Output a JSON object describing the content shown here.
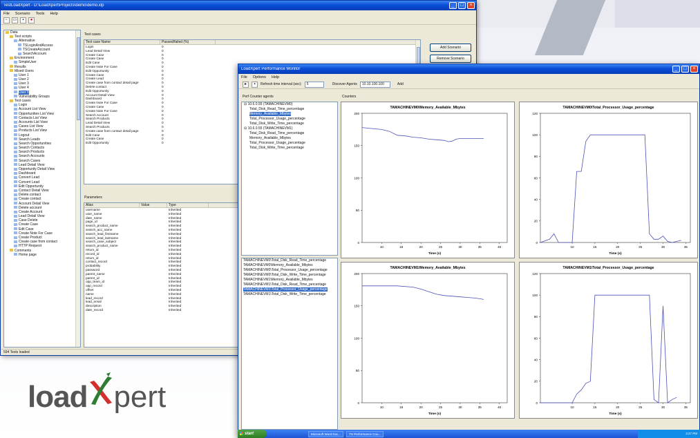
{
  "back_window": {
    "title": "TestLoadXpert - D:\\LoadXpert\\Projects\\demo\\demo.xlp",
    "menu": [
      "File",
      "Scenario",
      "Tools",
      "Help"
    ],
    "tree": [
      "Data",
      "Test scripts",
      "Alternative",
      "TSLoginAndAccess",
      "TSCreateAccount",
      "SearchAccount",
      "Environment",
      "SimpleUser",
      "Results",
      "Mixed Users",
      "User 1",
      "User 2",
      "User 3",
      "User 4",
      "User 5",
      "Vulnerability Groups",
      "Test cases",
      "Login",
      "Account List View",
      "Opportunities List View",
      "Contacts List View",
      "Accounts List View",
      "Cases List View",
      "Products List View",
      "Logout",
      "Search Leads",
      "Search Opportunities",
      "Search Contacts",
      "Search Products",
      "Search Accounts",
      "Search Cases",
      "Lead Detail View",
      "Opportunity Detail View",
      "Dashboard",
      "Convert Lead",
      "Convert Lead",
      "Edit Opportunity",
      "Contact Detail View",
      "Delete contact",
      "Create contact",
      "Account Detail View",
      "Delete account",
      "Create Account",
      "Lead Detail View",
      "Case Delete",
      "Create Case",
      "Edit Case",
      "Create Note For Case",
      "Create Product",
      "Create case from contact",
      "HTTP Request",
      "Comments",
      "Home page"
    ],
    "tree_selected": 14,
    "test_cases_label": "Test cases",
    "steps_header": [
      "Test case Name",
      "Passed/failed (%)"
    ],
    "steps": [
      [
        "Login",
        "0"
      ],
      [
        "Lead Detail View",
        "0"
      ],
      [
        "Create Case",
        "0"
      ],
      [
        "Create Case",
        "0"
      ],
      [
        "Edit Case",
        "0"
      ],
      [
        "Create Note For Case",
        "0"
      ],
      [
        "Edit Opportunity",
        "0"
      ],
      [
        "Create Case",
        "0"
      ],
      [
        "Create Lead",
        "0"
      ],
      [
        "Create case from contact detail page",
        "0"
      ],
      [
        "Delete contact",
        "0"
      ],
      [
        "Edit Opportunity",
        "0"
      ],
      [
        "Account Detail View",
        "0"
      ],
      [
        "Dashboard",
        "0"
      ],
      [
        "Create Note For Case",
        "0"
      ],
      [
        "Create Case",
        "0"
      ],
      [
        "Create Note For Case",
        "0"
      ],
      [
        "Search Account",
        "0"
      ],
      [
        "Search Products",
        "0"
      ],
      [
        "Lead Detail View",
        "0"
      ],
      [
        "Search Products",
        "0"
      ],
      [
        "Create case from contact detail page",
        "0"
      ],
      [
        "Edit Case",
        "0"
      ],
      [
        "Create Case",
        "0"
      ],
      [
        "Edit Opportunity",
        "0"
      ]
    ],
    "params_label": "Parameters",
    "params_header": [
      "Alias",
      "Value",
      "Type"
    ],
    "params": [
      [
        "username",
        "",
        "Inherited"
      ],
      [
        "user_name",
        "",
        "Inherited"
      ],
      [
        "date_name",
        "",
        "Inherited"
      ],
      [
        "page_id",
        "",
        "Inherited"
      ],
      [
        "search_product_name",
        "",
        "Inherited"
      ],
      [
        "search_acc_name",
        "",
        "Inherited"
      ],
      [
        "search_lead_firstname",
        "",
        "Inherited"
      ],
      [
        "search_lead_lastname",
        "",
        "Inherited"
      ],
      [
        "search_case_subject",
        "",
        "Inherited"
      ],
      [
        "search_product_name",
        "",
        "Inherited"
      ],
      [
        "return_id",
        "",
        "Inherited"
      ],
      [
        "record_id",
        "",
        "Inherited"
      ],
      [
        "return_id",
        "",
        "Inherited"
      ],
      [
        "contact_record",
        "",
        "Inherited"
      ],
      [
        "probability",
        "",
        "Inherited"
      ],
      [
        "password",
        "",
        "Inherited"
      ],
      [
        "parent_name",
        "",
        "Inherited"
      ],
      [
        "parent_id",
        "",
        "Inherited"
      ],
      [
        "opp_team_id",
        "",
        "Inherited"
      ],
      [
        "opp_record",
        "",
        "Inherited"
      ],
      [
        "offset",
        "",
        "Inherited"
      ],
      [
        "name",
        "",
        "Inherited"
      ],
      [
        "lead_record",
        "",
        "Inherited"
      ],
      [
        "lead_email",
        "",
        "Inherited"
      ],
      [
        "description",
        "",
        "Inherited"
      ],
      [
        "date_record",
        "",
        "Inherited"
      ]
    ],
    "add_scenario": "Add Scenario",
    "remove_scenario": "Remove Scenario",
    "status": "594 Tests loaded"
  },
  "front_window": {
    "title": "LoadXpert Performance Monitor",
    "menu": [
      "File",
      "Options",
      "Help"
    ],
    "refresh_label": "Refresh time interval (sec):",
    "refresh_value": "5",
    "discover_label": "Discover Agents",
    "ip_value": "10.10.100.100",
    "add_label": "Add",
    "tree_label": "Perf Counter agents",
    "tree": [
      {
        "label": "10.6.0.55 (TAMACHINEVM0)",
        "level": 0
      },
      {
        "label": "Total_Disk_Read_Time_percentage",
        "level": 1
      },
      {
        "label": "Memory_Available_Mbytes",
        "level": 1,
        "selected": true
      },
      {
        "label": "Total_Processor_Usage_percentage",
        "level": 1
      },
      {
        "label": "Total_Disk_Write_Time_percentage",
        "level": 1
      },
      {
        "label": "10.6.0.55 (TAMACHINEVM1)",
        "level": 0
      },
      {
        "label": "Total_Disk_Read_Time_percentage",
        "level": 1
      },
      {
        "label": "Memory_Available_Mbytes",
        "level": 1
      },
      {
        "label": "Total_Processor_Usage_percentage",
        "level": 1
      },
      {
        "label": "Total_Disk_Write_Time_percentage",
        "level": 1
      }
    ],
    "list": [
      "TAMACHINEVM0\\Total_Disk_Read_Time_percentage",
      "TAMACHINEVM0\\Memory_Available_Mbytes",
      "TAMACHINEVM0\\Total_Processor_Usage_percentage",
      "TAMACHINEVM0\\Total_Disk_Write_Time_percentage",
      "TAMACHINEVM1\\Memory_Available_Mbytes",
      "TAMACHINEVM1\\Total_Disk_Read_Time_percentage",
      "TAMACHINEVM1\\Total_Processor_Usage_percentage",
      "TAMACHINEVM1\\Total_Disk_Write_Time_percentage"
    ],
    "list_selected": 6,
    "counters_label": "Counters"
  },
  "chart_data": [
    {
      "type": "line",
      "title": "TAMACHINEVM0\\Memory_Available_Mbytes",
      "xlabel": "Time (s)",
      "ylabel": "",
      "xlim": [
        5,
        42
      ],
      "ylim": [
        0,
        200
      ],
      "xticks": [
        10,
        15,
        20,
        25,
        30,
        35,
        40
      ],
      "yticks": [
        0,
        50,
        100,
        150,
        200
      ],
      "series": [
        {
          "x": [
            5,
            8,
            10,
            12,
            14,
            16,
            18,
            20,
            22,
            24,
            26,
            27,
            28,
            29,
            30,
            32,
            34,
            36
          ],
          "values": [
            178,
            176,
            175,
            172,
            166,
            165,
            163,
            162,
            160,
            159,
            158,
            156,
            157,
            160,
            161,
            161,
            161,
            161
          ]
        }
      ]
    },
    {
      "type": "line",
      "title": "TAMACHINEVM0\\Total_Processor_Usage_percentage",
      "xlabel": "Time (s)",
      "ylabel": "",
      "xlim": [
        3,
        36
      ],
      "ylim": [
        0,
        120
      ],
      "xticks": [
        10,
        15,
        20,
        25,
        30,
        35
      ],
      "yticks": [
        0,
        20,
        40,
        60,
        80,
        100,
        120
      ],
      "series": [
        {
          "x": [
            3,
            5,
            6,
            7,
            8,
            9,
            10,
            11,
            12,
            13,
            14,
            15,
            20,
            25,
            26,
            27,
            28,
            29,
            30,
            31,
            32,
            34
          ],
          "values": [
            0,
            3,
            8,
            0,
            0,
            0,
            0,
            66,
            66,
            94,
            100,
            100,
            100,
            100,
            100,
            8,
            3,
            3,
            6,
            1,
            0,
            2
          ]
        }
      ]
    },
    {
      "type": "line",
      "title": "TAMACHINEVM1\\Memory_Available_Mbytes",
      "xlabel": "Time (s)",
      "ylabel": "",
      "xlim": [
        5,
        42
      ],
      "ylim": [
        0,
        200
      ],
      "xticks": [
        10,
        15,
        20,
        25,
        30,
        35,
        40
      ],
      "yticks": [
        0,
        50,
        100,
        150,
        200
      ],
      "series": [
        {
          "x": [
            5,
            8,
            10,
            14,
            18,
            20,
            22,
            24,
            26,
            28,
            30,
            32,
            34,
            36
          ],
          "values": [
            181,
            181,
            181,
            181,
            179,
            176,
            172,
            168,
            166,
            165,
            164,
            163,
            162,
            160
          ]
        }
      ]
    },
    {
      "type": "line",
      "title": "TAMACHINEVM1\\Total_Processor_Usage_percentage",
      "xlabel": "Time (s)",
      "ylabel": "",
      "xlim": [
        3,
        36
      ],
      "ylim": [
        0,
        120
      ],
      "xticks": [
        10,
        15,
        20,
        25,
        30,
        35
      ],
      "yticks": [
        0,
        20,
        40,
        60,
        80,
        100,
        120
      ],
      "series": [
        {
          "x": [
            3,
            5,
            7,
            10,
            11,
            12,
            13,
            14,
            15,
            17,
            19,
            21,
            23,
            25,
            27,
            28,
            29,
            30,
            31,
            32,
            33
          ],
          "values": [
            0,
            0,
            0,
            0,
            8,
            12,
            18,
            20,
            100,
            100,
            100,
            100,
            100,
            100,
            100,
            3,
            0,
            90,
            0,
            3,
            5
          ]
        }
      ]
    }
  ],
  "taskbar": {
    "start": "start",
    "tasks": [
      "Microsoft Word Doc...",
      "TS Performance Cou..."
    ],
    "clock": "3:27 PM"
  },
  "logo": {
    "part1": "load",
    "part2": "pert"
  },
  "colors": {
    "title_bar": "#0a4ed6",
    "line": "#4b4fb8",
    "accent_red": "#d32f2f",
    "accent_green": "#2e7d32"
  }
}
